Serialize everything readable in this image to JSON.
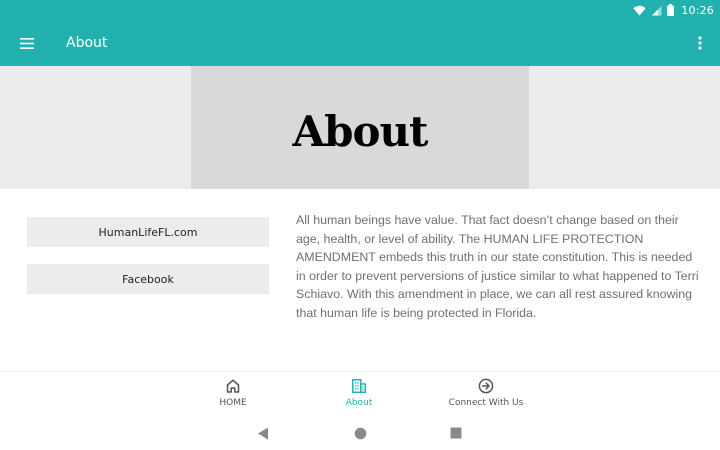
{
  "status_bar": {
    "time": "10:26"
  },
  "app_bar": {
    "title": "About"
  },
  "hero": {
    "heading": "About"
  },
  "buttons": {
    "site": "HumanLifeFL.com",
    "facebook": "Facebook"
  },
  "body": {
    "text": "All human beings have value. That fact doesn’t change based on their age, health, or level of ability. The HUMAN LIFE PROTECTION AMENDMENT embeds this truth in our state constitution. This is needed in order to prevent perversions of justice similar to what happened to Terri Schiavo. With this amendment in place, we can all rest assured knowing that human life is being protected in Florida."
  },
  "bottom_nav": {
    "items": [
      {
        "label": "HOME",
        "icon": "home-icon",
        "active": false
      },
      {
        "label": "About",
        "icon": "building-icon",
        "active": true
      },
      {
        "label": "Connect With Us",
        "icon": "arrow-circle-right-icon",
        "active": false
      }
    ]
  },
  "colors": {
    "primary": "#23b1b0",
    "hero_bg": "#ececee",
    "hero_box": "#d9d9d9",
    "body_text": "#707070"
  }
}
